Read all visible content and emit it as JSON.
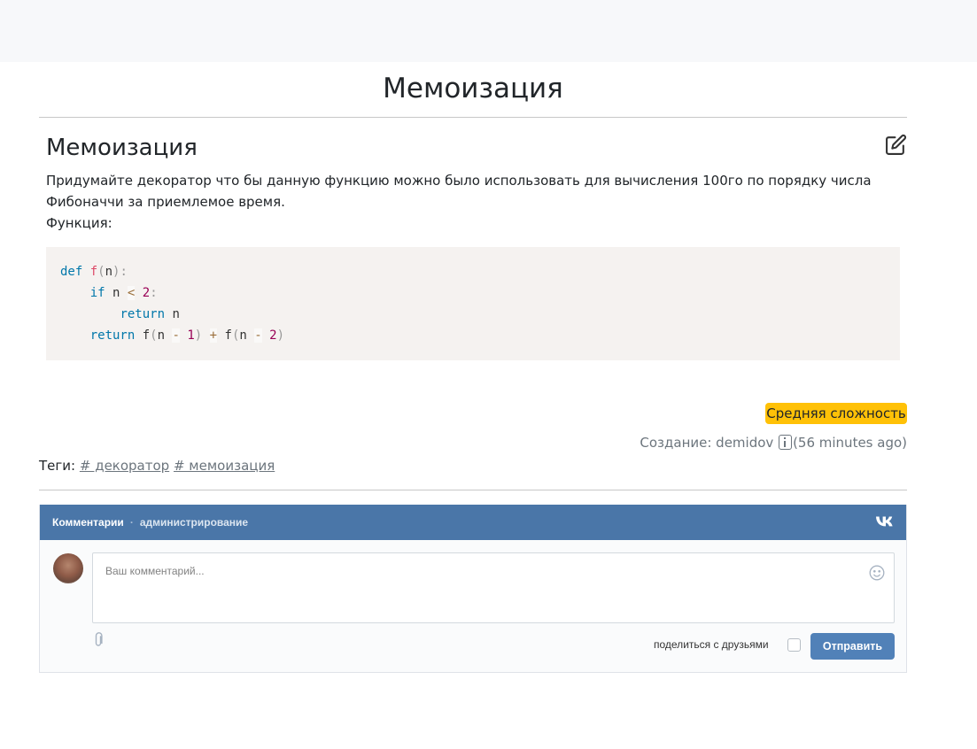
{
  "page": {
    "title": "Мемоизация"
  },
  "task": {
    "title": "Мемоизация",
    "description": "Придумайте декоратор что бы данную функцию можно было использовать для вычисления 100го по порядку числа Фибоначчи за приемлемое время.",
    "function_label": "Функция:",
    "code_lines": [
      "def f(n):",
      "    if n < 2:",
      "        return n",
      "    return f(n - 1) + f(n - 2)"
    ]
  },
  "difficulty": {
    "label": "Средняя сложность",
    "color": "#ffc107"
  },
  "meta": {
    "created_prefix": "Создание: demidov",
    "created_time": "(56 minutes ago)"
  },
  "tags": {
    "label": "Теги:",
    "items": [
      "# декоратор",
      "# мемоизация"
    ]
  },
  "comments_widget": {
    "title": "Комментарии",
    "separator": "·",
    "admin_label": "администрирование",
    "placeholder": "Ваш комментарий...",
    "share_label": "поделиться с друзьями",
    "share_checked": false,
    "send_label": "Отправить",
    "header_color": "#4a76a8",
    "logo_icon": "vk-logo-icon",
    "emoji_icon": "smile-icon",
    "attach_icon": "paperclip-icon"
  }
}
